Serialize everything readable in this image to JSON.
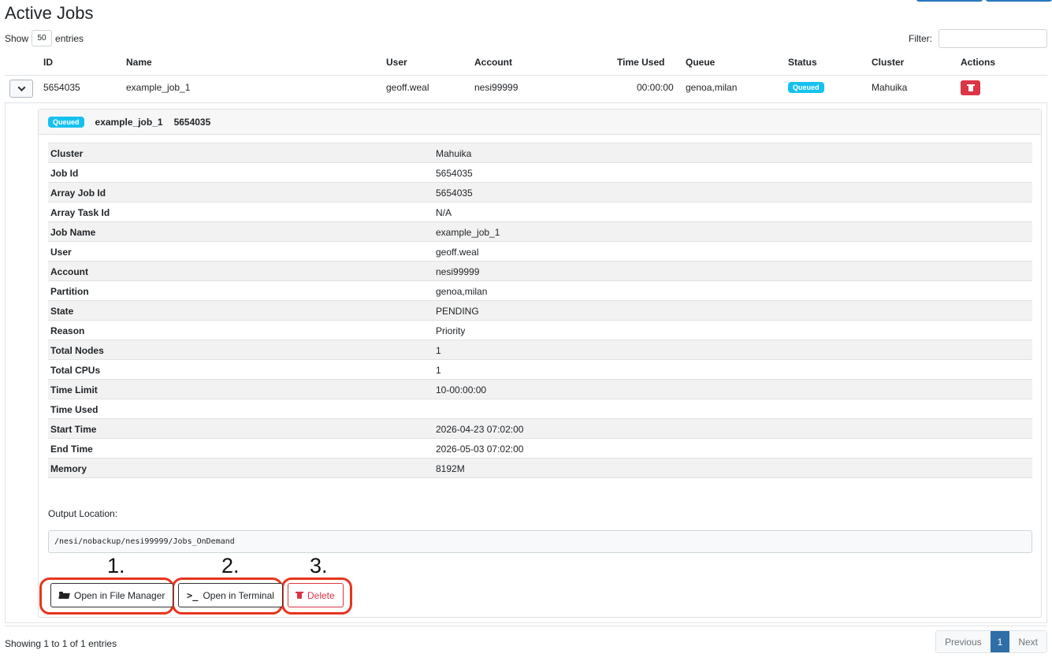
{
  "page": {
    "title": "Active Jobs"
  },
  "length_control": {
    "show_label": "Show",
    "value": "50",
    "entries_label": "entries"
  },
  "filter": {
    "label": "Filter:",
    "value": ""
  },
  "table": {
    "headers": [
      "ID",
      "Name",
      "User",
      "Account",
      "Time Used",
      "Queue",
      "Status",
      "Cluster",
      "Actions"
    ],
    "row": {
      "id": "5654035",
      "name": "example_job_1",
      "user": "geoff.weal",
      "account": "nesi99999",
      "time_used": "00:00:00",
      "queue": "genoa,milan",
      "status": "Queued",
      "cluster": "Mahuika"
    }
  },
  "detail": {
    "header": {
      "status": "Queued",
      "name": "example_job_1",
      "id": "5654035"
    },
    "rows": [
      {
        "k": "Cluster",
        "v": "Mahuika"
      },
      {
        "k": "Job Id",
        "v": "5654035"
      },
      {
        "k": "Array Job Id",
        "v": "5654035"
      },
      {
        "k": "Array Task Id",
        "v": "N/A"
      },
      {
        "k": "Job Name",
        "v": "example_job_1"
      },
      {
        "k": "User",
        "v": "geoff.weal"
      },
      {
        "k": "Account",
        "v": "nesi99999"
      },
      {
        "k": "Partition",
        "v": "genoa,milan"
      },
      {
        "k": "State",
        "v": "PENDING"
      },
      {
        "k": "Reason",
        "v": "Priority"
      },
      {
        "k": "Total Nodes",
        "v": "1"
      },
      {
        "k": "Total CPUs",
        "v": "1"
      },
      {
        "k": "Time Limit",
        "v": "10-00:00:00"
      },
      {
        "k": "Time Used",
        "v": ""
      },
      {
        "k": "Start Time",
        "v": "2026-04-23 07:02:00"
      },
      {
        "k": "End Time",
        "v": "2026-05-03 07:02:00"
      },
      {
        "k": "Memory",
        "v": "8192M"
      }
    ],
    "output_label": "Output Location:",
    "output_path": "/nesi/nobackup/nesi99999/Jobs_OnDemand",
    "actions": {
      "file_manager": "Open in File Manager",
      "terminal": "Open in Terminal",
      "delete": "Delete"
    },
    "annotations": [
      "1.",
      "2.",
      "3."
    ]
  },
  "footer": {
    "info": "Showing 1 to 1 of 1 entries",
    "previous": "Previous",
    "page": "1",
    "next": "Next"
  },
  "colors": {
    "badge": "#16c1ef",
    "danger": "#dc3545",
    "annotation_ring": "#e8341c",
    "pager_active": "#2f6ea6"
  }
}
